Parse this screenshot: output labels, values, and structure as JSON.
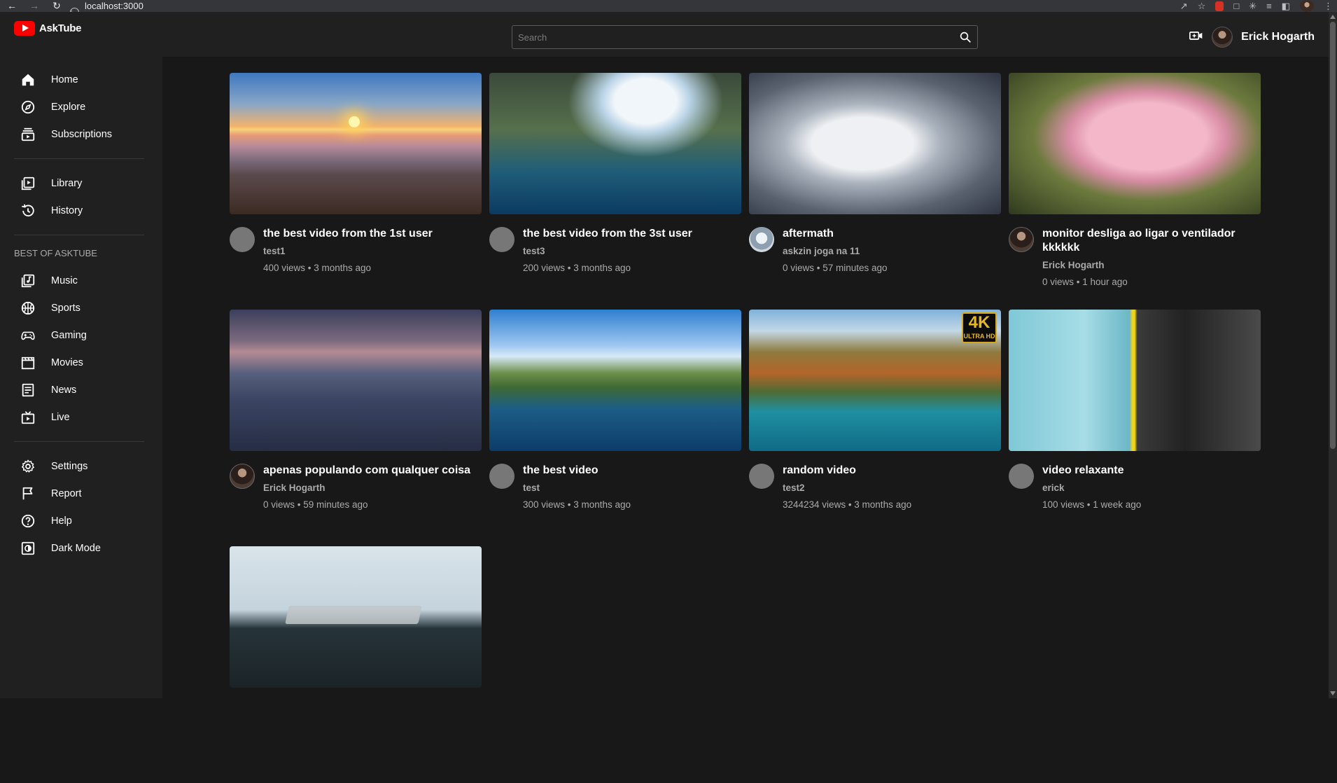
{
  "browser": {
    "url": "localhost:3000"
  },
  "app": {
    "name": "AskTube"
  },
  "search": {
    "placeholder": "Search"
  },
  "user": {
    "name": "Erick Hogarth"
  },
  "sidebar": {
    "main": [
      {
        "label": "Home",
        "icon": "home-icon"
      },
      {
        "label": "Explore",
        "icon": "compass-icon"
      },
      {
        "label": "Subscriptions",
        "icon": "subscriptions-icon"
      }
    ],
    "library": [
      {
        "label": "Library",
        "icon": "library-icon"
      },
      {
        "label": "History",
        "icon": "history-icon"
      }
    ],
    "best_title": "BEST OF ASKTUBE",
    "best": [
      {
        "label": "Music",
        "icon": "music-icon"
      },
      {
        "label": "Sports",
        "icon": "sports-icon"
      },
      {
        "label": "Gaming",
        "icon": "gaming-icon"
      },
      {
        "label": "Movies",
        "icon": "movies-icon"
      },
      {
        "label": "News",
        "icon": "news-icon"
      },
      {
        "label": "Live",
        "icon": "live-icon"
      }
    ],
    "bottom": [
      {
        "label": "Settings",
        "icon": "settings-icon"
      },
      {
        "label": "Report",
        "icon": "flag-icon"
      },
      {
        "label": "Help",
        "icon": "help-icon"
      },
      {
        "label": "Dark Mode",
        "icon": "dark-mode-icon"
      }
    ]
  },
  "videos": [
    {
      "title": "the best video from the 1st user",
      "channel": "test1",
      "meta": "400 views • 3 months ago"
    },
    {
      "title": "the best video from the 3st user",
      "channel": "test3",
      "meta": "200 views • 3 months ago"
    },
    {
      "title": "aftermath",
      "channel": "askzin joga na 11",
      "meta": "0 views • 57 minutes ago"
    },
    {
      "title": "monitor desliga ao ligar o ventilador kkkkkk",
      "channel": "Erick Hogarth",
      "meta": "0 views • 1 hour ago"
    },
    {
      "title": "apenas populando com qualquer coisa",
      "channel": "Erick Hogarth",
      "meta": "0 views • 59 minutes ago"
    },
    {
      "title": "the best video",
      "channel": "test",
      "meta": "300 views • 3 months ago"
    },
    {
      "title": "random video",
      "channel": "test2",
      "meta": "3244234 views • 3 months ago"
    },
    {
      "title": "video relaxante",
      "channel": "erick",
      "meta": "100 views • 1 week ago"
    }
  ],
  "badge": {
    "main": "4K",
    "sub": "ULTRA HD"
  }
}
